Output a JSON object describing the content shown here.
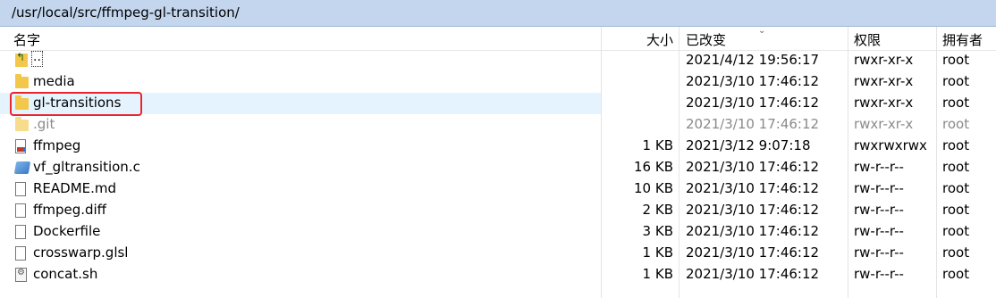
{
  "path": "/usr/local/src/ffmpeg-gl-transition/",
  "headers": {
    "name": "名字",
    "size": "大小",
    "modified": "已改变",
    "permissions": "权限",
    "owner": "拥有者"
  },
  "rows": [
    {
      "name": "..",
      "size": "",
      "modified": "2021/4/12 19:56:17",
      "perm": "rwxr-xr-x",
      "owner": "root",
      "icon": "parent-folder-icon"
    },
    {
      "name": "media",
      "size": "",
      "modified": "2021/3/10 17:46:12",
      "perm": "rwxr-xr-x",
      "owner": "root",
      "icon": "folder-icon"
    },
    {
      "name": "gl-transitions",
      "size": "",
      "modified": "2021/3/10 17:46:12",
      "perm": "rwxr-xr-x",
      "owner": "root",
      "icon": "folder-icon",
      "selected": true
    },
    {
      "name": ".git",
      "size": "",
      "modified": "2021/3/10 17:46:12",
      "perm": "rwxr-xr-x",
      "owner": "root",
      "icon": "folder-icon",
      "hidden": true
    },
    {
      "name": "ffmpeg",
      "size": "1 KB",
      "modified": "2021/3/12 9:07:18",
      "perm": "rwxrwxrwx",
      "owner": "root",
      "icon": "executable-file-icon"
    },
    {
      "name": "vf_gltransition.c",
      "size": "16 KB",
      "modified": "2021/3/10 17:46:12",
      "perm": "rw-r--r--",
      "owner": "root",
      "icon": "c-source-file-icon"
    },
    {
      "name": "README.md",
      "size": "10 KB",
      "modified": "2021/3/10 17:46:12",
      "perm": "rw-r--r--",
      "owner": "root",
      "icon": "file-icon"
    },
    {
      "name": "ffmpeg.diff",
      "size": "2 KB",
      "modified": "2021/3/10 17:46:12",
      "perm": "rw-r--r--",
      "owner": "root",
      "icon": "file-icon"
    },
    {
      "name": "Dockerfile",
      "size": "3 KB",
      "modified": "2021/3/10 17:46:12",
      "perm": "rw-r--r--",
      "owner": "root",
      "icon": "file-icon"
    },
    {
      "name": "crosswarp.glsl",
      "size": "1 KB",
      "modified": "2021/3/10 17:46:12",
      "perm": "rw-r--r--",
      "owner": "root",
      "icon": "file-icon"
    },
    {
      "name": "concat.sh",
      "size": "1 KB",
      "modified": "2021/3/10 17:46:12",
      "perm": "rw-r--r--",
      "owner": "root",
      "icon": "shell-script-icon"
    }
  ],
  "colors": {
    "pathbar": "#c3d6ee",
    "selection": "#e5f3ff",
    "highlight_box": "#e8262b"
  }
}
